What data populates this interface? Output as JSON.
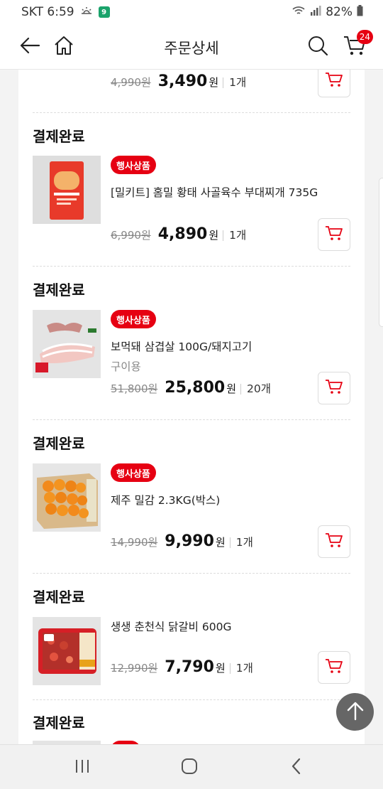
{
  "status_bar": {
    "carrier_time": "SKT 6:59",
    "badge_text": "9",
    "battery": "82%"
  },
  "header": {
    "title": "주문상세",
    "cart_count": "24"
  },
  "top_partial": {
    "orig_price": "4,990원",
    "sale_price": "3,490",
    "won": "원",
    "qty": "1개"
  },
  "orders": [
    {
      "status": "결제완료",
      "tag": "행사상품",
      "name": "[밀키트] 홈밀 황태 사골육수 부대찌개 735G",
      "option": "",
      "orig_price": "6,990원",
      "sale_price": "4,890",
      "won": "원",
      "qty": "1개"
    },
    {
      "status": "결제완료",
      "tag": "행사상품",
      "name": "보먹돼 삼겹살 100G/돼지고기",
      "option": "구이용",
      "orig_price": "51,800원",
      "sale_price": "25,800",
      "won": "원",
      "qty": "20개"
    },
    {
      "status": "결제완료",
      "tag": "행사상품",
      "name": "제주 밀감 2.3KG(박스)",
      "option": "",
      "orig_price": "14,990원",
      "sale_price": "9,990",
      "won": "원",
      "qty": "1개"
    },
    {
      "status": "결제완료",
      "tag": "",
      "name": "생생 춘천식 닭갈비 600G",
      "option": "",
      "orig_price": "12,990원",
      "sale_price": "7,790",
      "won": "원",
      "qty": "1개"
    },
    {
      "status": "결제완료"
    }
  ],
  "icons": {
    "back": "arrow-left-icon",
    "home": "home-icon",
    "search": "search-icon",
    "cart": "cart-icon",
    "scroll_top": "arrow-up-icon"
  },
  "colors": {
    "accent": "#e60012",
    "text": "#111111",
    "muted": "#888888"
  }
}
